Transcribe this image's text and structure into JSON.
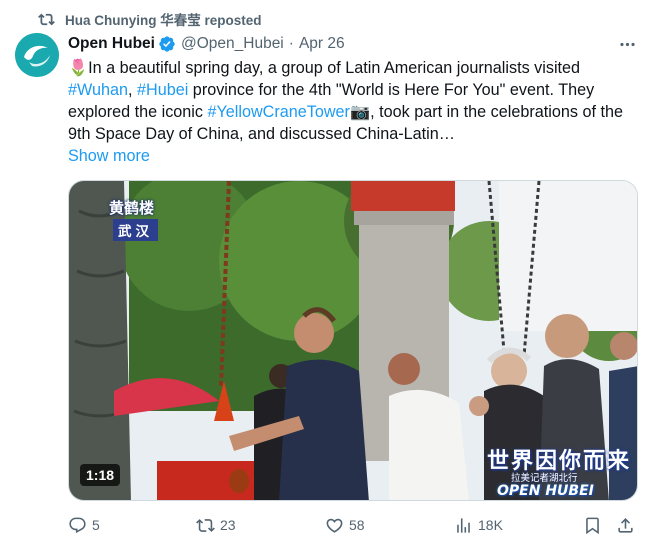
{
  "repost": {
    "label": "Hua Chunying 华春莹 reposted",
    "icon": "repost-icon"
  },
  "author": {
    "name": "Open Hubei",
    "handle": "@Open_Hubei",
    "separator": "·",
    "date": "Apr 26",
    "verified_color": "#1d9bf0"
  },
  "tweet": {
    "emoji": "🌷",
    "text_1": "In a beautiful spring day, a group of Latin American journalists visited ",
    "tag_wuhan": "#Wuhan",
    "comma": ", ",
    "tag_hubei": "#Hubei",
    "text_2": " province for the 4th \"World is Here For You\" event. They explored the iconic ",
    "tag_tower": "#YellowCraneTower",
    "camera": "📷",
    "text_3": ", took part in the celebrations of the 9th Space Day of China, and discussed China-Latin…",
    "show_more": "Show more"
  },
  "video": {
    "location_title": "黄鹤楼",
    "location_city": "武汉",
    "duration": "1:18",
    "brand_title": "世界因你而来",
    "brand_subtitle": "拉美记者湖北行",
    "brand_logo": "OPEN HUBEI"
  },
  "actions": {
    "replies": "5",
    "reposts": "23",
    "likes": "58",
    "views": "18K"
  },
  "colors": {
    "accent": "#1d9bf0",
    "muted": "#536471",
    "text": "#0f1419"
  }
}
